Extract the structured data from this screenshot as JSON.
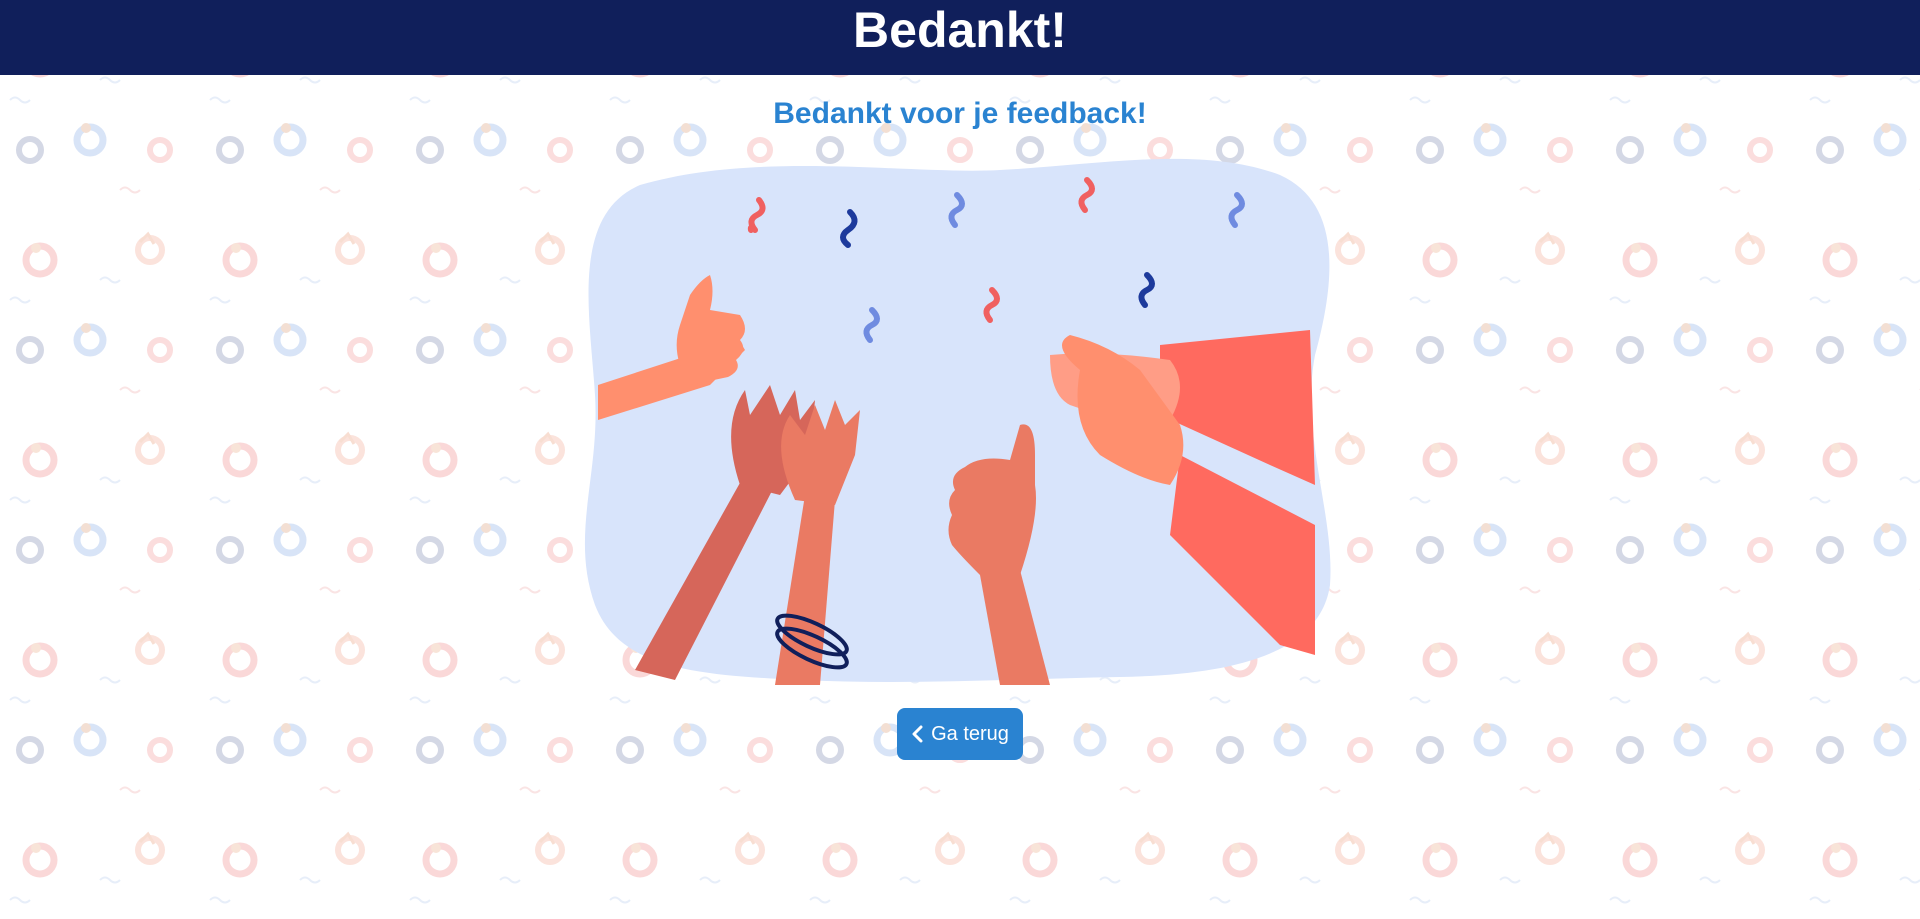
{
  "header": {
    "title": "Bedankt!",
    "background_color": "#101f5b"
  },
  "main": {
    "subtitle": "Bedankt voor je feedback!",
    "subtitle_color": "#2a83d1",
    "illustration": {
      "icon": "clapping-hands-illustration",
      "background_color": "#d8e4fb"
    }
  },
  "back_button": {
    "label": "Ga terug",
    "icon": "chevron-left-icon",
    "color": "#2a83d1"
  },
  "background": {
    "pattern_icon": "swim-ring-pattern",
    "colors": [
      "#f6c5c5",
      "#c9d8f1",
      "#f7d3c2"
    ]
  }
}
